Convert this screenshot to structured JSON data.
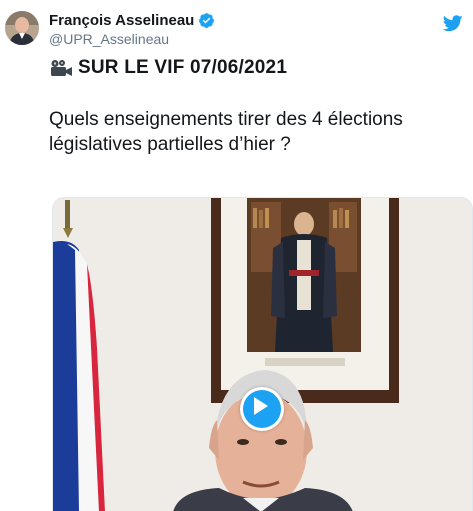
{
  "tweet": {
    "display_name": "François Asselineau",
    "handle": "@UPR_Asselineau",
    "verified": true,
    "headline_icon": "movie-camera-icon",
    "headline": "SUR LE VIF 07/06/2021",
    "text": "Quels enseignements tirer des 4 élections législatives partielles d’hier ?"
  },
  "media": {
    "type": "video",
    "play_icon": "play-icon",
    "accent_color": "#1da1f2"
  },
  "icons": {
    "verified": "verified-badge-icon",
    "brand": "twitter-bird-icon"
  }
}
